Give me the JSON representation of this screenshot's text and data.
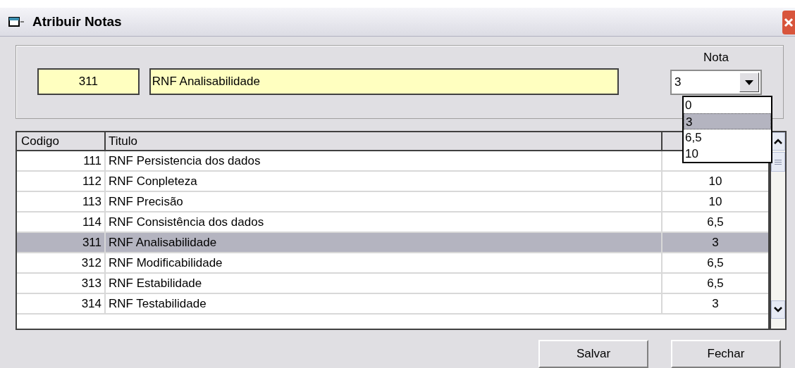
{
  "window": {
    "title": "Atribuir Notas"
  },
  "current": {
    "codigo": "311",
    "titulo": "RNF Analisabilidade"
  },
  "nota": {
    "label": "Nota",
    "value": "3",
    "expanded": true,
    "options": [
      {
        "label": "0",
        "selected": false
      },
      {
        "label": "3",
        "selected": true
      },
      {
        "label": "6,5",
        "selected": false
      },
      {
        "label": "10",
        "selected": false
      }
    ]
  },
  "table": {
    "columns": [
      "Codigo",
      "Titulo"
    ],
    "rows": [
      {
        "codigo": "111",
        "titulo": "RNF Persistencia dos dados",
        "selected": false
      },
      {
        "codigo": "112",
        "titulo": "RNF Conpleteza",
        "nota": "10",
        "selected": false
      },
      {
        "codigo": "113",
        "titulo": "RNF Precisão",
        "nota": "10",
        "selected": false
      },
      {
        "codigo": "114",
        "titulo": "RNF Consistência dos dados",
        "nota": "6,5",
        "selected": false
      },
      {
        "codigo": "311",
        "titulo": "RNF Analisabilidade",
        "nota": "3",
        "selected": true
      },
      {
        "codigo": "312",
        "titulo": "RNF Modificabilidade",
        "nota": "6,5",
        "selected": false
      },
      {
        "codigo": "313",
        "titulo": "RNF Estabilidade",
        "nota": "6,5",
        "selected": false
      },
      {
        "codigo": "314",
        "titulo": "RNF Testabilidade",
        "nota": "3",
        "selected": false
      }
    ]
  },
  "buttons": [
    "Salvar",
    "Fechar"
  ]
}
